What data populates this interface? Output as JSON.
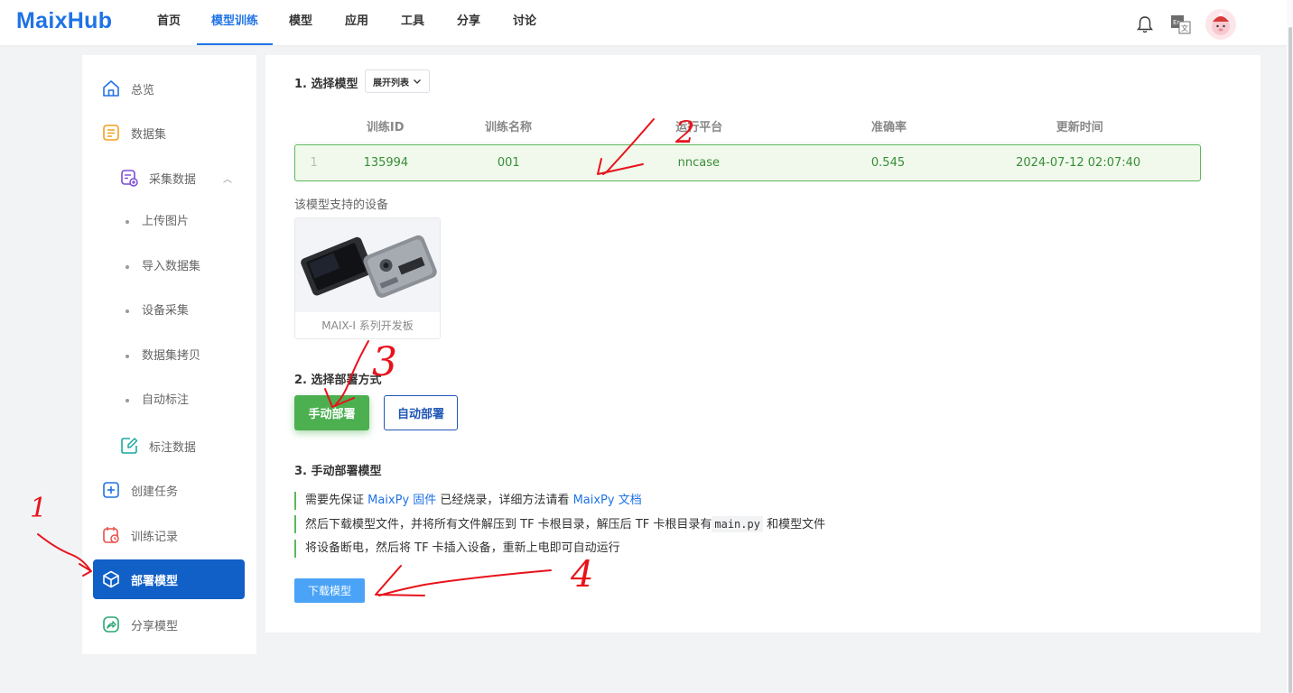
{
  "app": {
    "logo": "MaixHub"
  },
  "nav": {
    "items": [
      {
        "label": "首页"
      },
      {
        "label": "模型训练"
      },
      {
        "label": "模型"
      },
      {
        "label": "应用"
      },
      {
        "label": "工具"
      },
      {
        "label": "分享"
      },
      {
        "label": "讨论"
      }
    ],
    "active_index": 1,
    "lang_label": "En 文"
  },
  "sidebar": {
    "items": [
      {
        "label": "总览",
        "icon": "home-icon"
      },
      {
        "label": "数据集",
        "icon": "document-icon"
      },
      {
        "label": "采集数据",
        "icon": "collect-icon"
      },
      {
        "label": "上传图片"
      },
      {
        "label": "导入数据集"
      },
      {
        "label": "设备采集"
      },
      {
        "label": "数据集拷贝"
      },
      {
        "label": "自动标注"
      },
      {
        "label": "标注数据",
        "icon": "annotate-icon"
      },
      {
        "label": "创建任务",
        "icon": "plus-square-icon"
      },
      {
        "label": "训练记录",
        "icon": "history-icon"
      },
      {
        "label": "部署模型",
        "icon": "cube-icon"
      },
      {
        "label": "分享模型",
        "icon": "share-icon"
      }
    ],
    "active": "部署模型"
  },
  "main": {
    "section1_title": "1. 选择模型",
    "expand_label": "展开列表",
    "table": {
      "headers": [
        "",
        "训练ID",
        "训练名称",
        "运行平台",
        "准确率",
        "更新时间"
      ],
      "rows": [
        {
          "index": "1",
          "id": "135994",
          "name": "001",
          "platform": "nncase",
          "accuracy": "0.545",
          "updated": "2024-07-12 02:07:40"
        }
      ]
    },
    "devices_label": "该模型支持的设备",
    "device": {
      "name": "MAIX-I 系列开发板"
    },
    "section2_title": "2. 选择部署方式",
    "manual_label": "手动部署",
    "auto_label": "自动部署",
    "section3_title": "3. 手动部署模型",
    "steps": {
      "s1_a": "需要先保证 ",
      "s1_link1": "MaixPy 固件",
      "s1_b": " 已经烧录，详细方法请看 ",
      "s1_link2": "MaixPy 文档",
      "s2_a": "然后下载模型文件，并将所有文件解压到 TF 卡根目录，解压后 TF 卡根目录有",
      "s2_code": "main.py",
      "s2_b": " 和模型文件",
      "s3": "将设备断电，然后将 TF 卡插入设备，重新上电即可自动运行"
    },
    "download_label": "下载模型"
  },
  "annotations": {
    "n1": "1",
    "n2": "2",
    "n3": "3",
    "n4": "4",
    "color": "#e8121b"
  }
}
